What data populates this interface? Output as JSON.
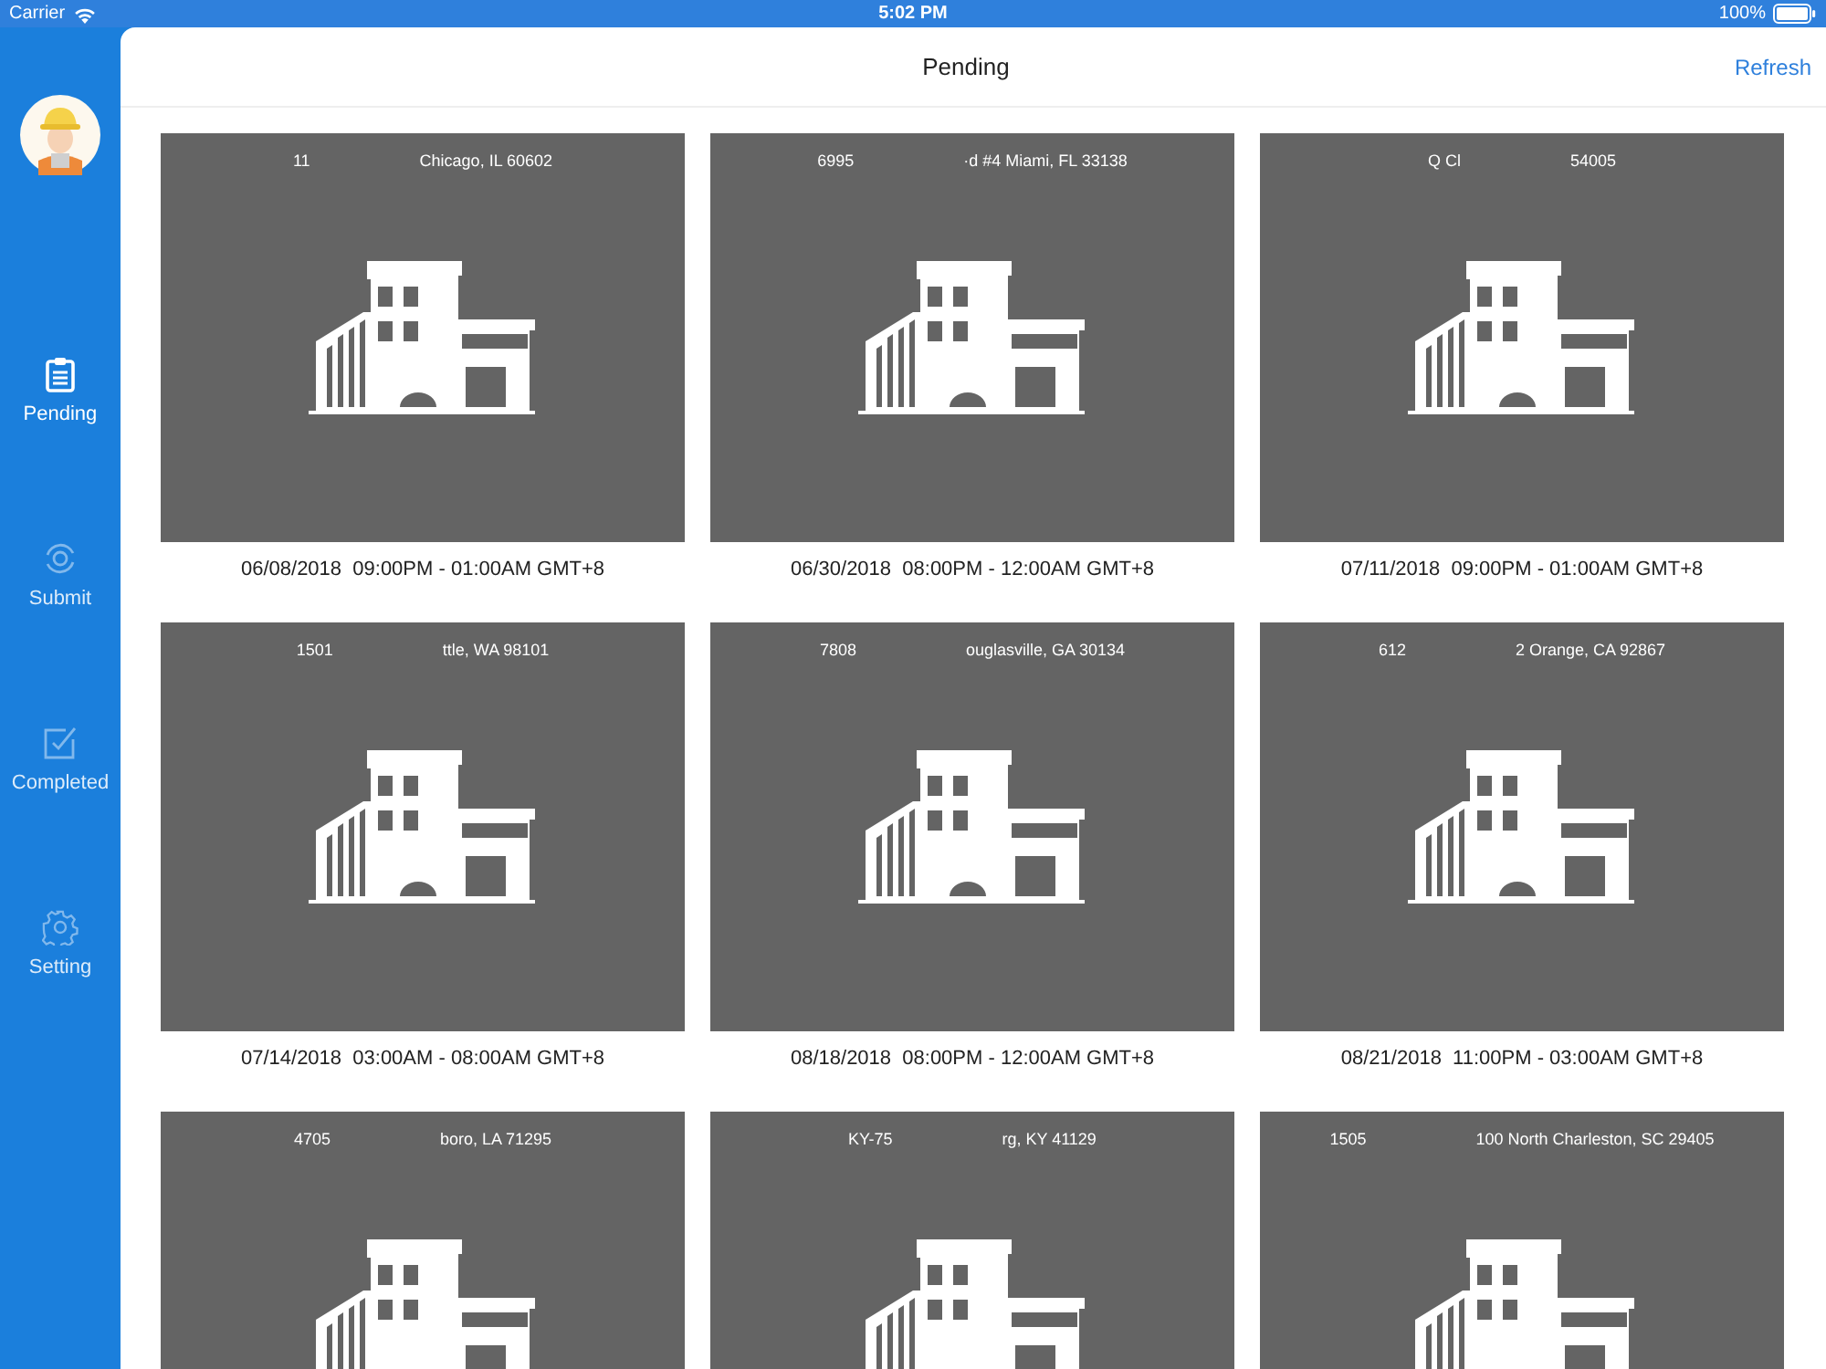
{
  "status_bar": {
    "carrier": "Carrier",
    "time": "5:02 PM",
    "battery": "100%"
  },
  "sidebar": {
    "items": [
      {
        "label": "Pending",
        "kind": "clipboard",
        "selected": true
      },
      {
        "label": "Submit",
        "kind": "sync",
        "selected": false
      },
      {
        "label": "Completed",
        "kind": "check",
        "selected": false
      },
      {
        "label": "Setting",
        "kind": "gear",
        "selected": false
      }
    ]
  },
  "header": {
    "title": "Pending",
    "action": "Refresh"
  },
  "jobs": [
    {
      "address_number": "11",
      "address_rest": "Chicago, IL 60602",
      "schedule": "06/08/2018  09:00PM - 01:00AM GMT+8"
    },
    {
      "address_number": "6995",
      "address_rest": "·d #4  Miami, FL 33138",
      "schedule": "06/30/2018  08:00PM - 12:00AM GMT+8"
    },
    {
      "address_number": "Q  Cl",
      "address_rest": "54005",
      "schedule": "07/11/2018  09:00PM - 01:00AM GMT+8"
    },
    {
      "address_number": "1501",
      "address_rest": "ttle, WA 98101",
      "schedule": "07/14/2018  03:00AM - 08:00AM GMT+8"
    },
    {
      "address_number": "7808",
      "address_rest": "ouglasville, GA 30134",
      "schedule": "08/18/2018  08:00PM - 12:00AM GMT+8"
    },
    {
      "address_number": "612",
      "address_rest": "2 Orange, CA 92867",
      "schedule": "08/21/2018  11:00PM - 03:00AM GMT+8"
    },
    {
      "address_number": "4705",
      "address_rest": "boro, LA 71295"
    },
    {
      "address_number": "KY-75",
      "address_rest": "rg, KY 41129"
    },
    {
      "address_number": "1505",
      "address_rest": "100  North Charleston, SC 29405"
    }
  ]
}
